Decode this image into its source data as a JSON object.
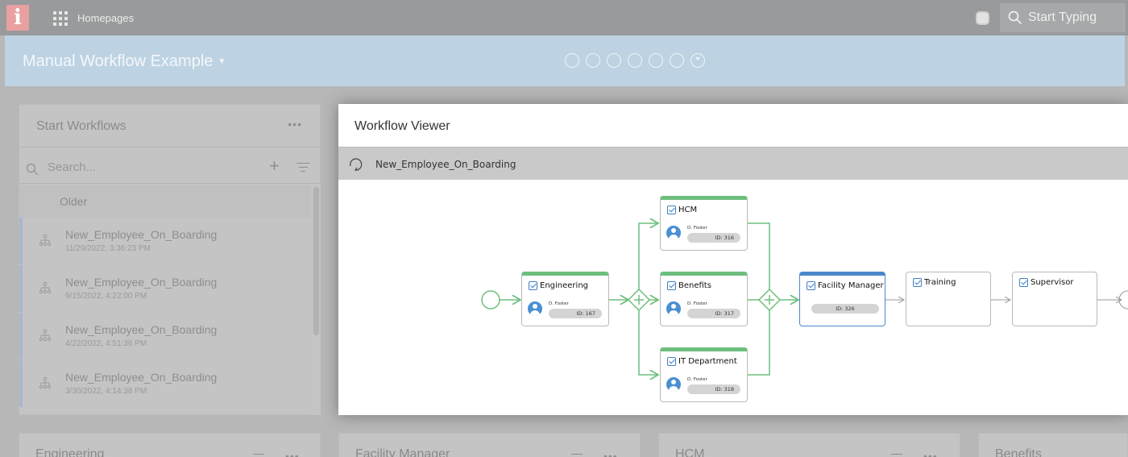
{
  "topbar": {
    "logo_text": "i",
    "homepages_label": "Homepages",
    "search_placeholder": "Start Typing"
  },
  "header": {
    "title": "Manual Workflow Example",
    "page_dots": 7,
    "active_dot": 7
  },
  "start_workflows": {
    "title": "Start Workflows",
    "more": "•••",
    "search_placeholder": "Search...",
    "group_label": "Older",
    "items": [
      {
        "name": "New_Employee_On_Boarding",
        "date": "11/29/2022, 3:36:23 PM"
      },
      {
        "name": "New_Employee_On_Boarding",
        "date": "9/15/2022, 4:22:00 PM"
      },
      {
        "name": "New_Employee_On_Boarding",
        "date": "4/22/2022, 4:51:36 PM"
      },
      {
        "name": "New_Employee_On_Boarding",
        "date": "3/30/2022, 4:14:38 PM"
      }
    ]
  },
  "viewer": {
    "title": "Workflow Viewer",
    "workflow_name": "New_Employee_On_Boarding",
    "nodes": {
      "engineering": {
        "label": "Engineering",
        "person": "D. Foster",
        "id": "ID: 167",
        "status": "complete"
      },
      "hcm": {
        "label": "HCM",
        "person": "D. Foster",
        "id": "ID: 316",
        "status": "complete"
      },
      "benefits": {
        "label": "Benefits",
        "person": "D. Foster",
        "id": "ID: 317",
        "status": "complete"
      },
      "it": {
        "label": "IT Department",
        "person": "D. Foster",
        "id": "ID: 318",
        "status": "complete"
      },
      "facility": {
        "label": "Facility Manager",
        "id": "ID: 326",
        "status": "active"
      },
      "training": {
        "label": "Training",
        "status": "pending"
      },
      "supervisor": {
        "label": "Supervisor",
        "status": "pending"
      }
    },
    "colors": {
      "complete": "#6dbf7e",
      "active": "#4a88c9",
      "pending": "#9a9a9a"
    }
  },
  "bottom_widgets": [
    {
      "title": "Engineering",
      "more": "•••"
    },
    {
      "title": "Facility Manager",
      "more": "•••"
    },
    {
      "title": "HCM",
      "more": "•••"
    },
    {
      "title": "Benefits"
    }
  ]
}
